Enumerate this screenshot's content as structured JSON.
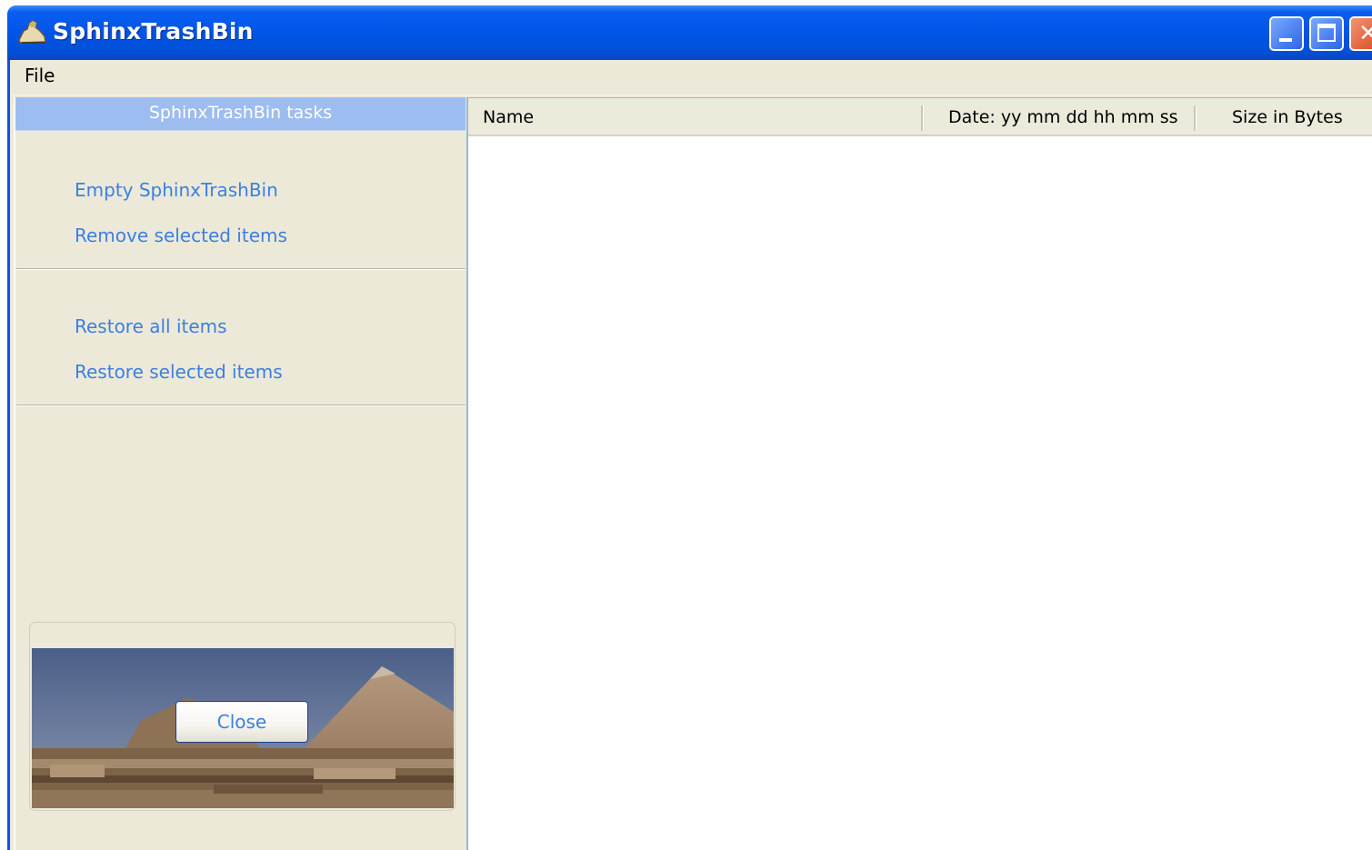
{
  "window": {
    "title": "SphinxTrashBin",
    "app_icon": "sphinx-icon",
    "controls": [
      "minimize-icon",
      "maximize-icon",
      "close-icon"
    ]
  },
  "menubar": {
    "items": [
      {
        "label": "File"
      }
    ]
  },
  "sidebar": {
    "header": "SphinxTrashBin tasks",
    "groups": [
      {
        "items": [
          {
            "label": "Empty SphinxTrashBin"
          },
          {
            "label": "Remove selected items"
          }
        ]
      },
      {
        "items": [
          {
            "label": "Restore all items"
          },
          {
            "label": "Restore selected items"
          }
        ]
      }
    ],
    "close_button": "Close"
  },
  "list": {
    "columns": [
      "Name",
      "Date: yy mm dd hh mm ss",
      "Size in Bytes"
    ],
    "rows": []
  },
  "colors": {
    "titlebar": "#0055e6",
    "client_background": "#ece9d8",
    "task_header": "#9dbdf0",
    "link": "#3d7fe0"
  }
}
